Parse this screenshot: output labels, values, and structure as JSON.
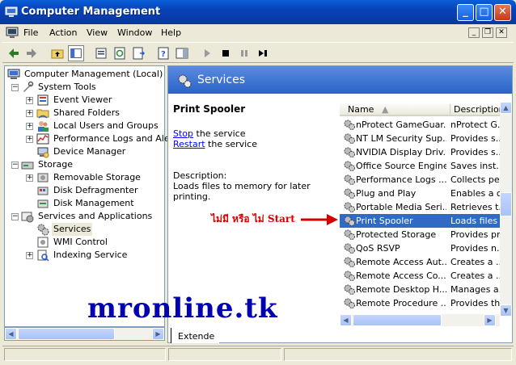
{
  "window": {
    "title": "Computer Management",
    "minimize_symbol": "_",
    "maximize_symbol": "□",
    "close_symbol": "✕"
  },
  "menu": {
    "items": [
      "File",
      "Action",
      "View",
      "Window",
      "Help"
    ],
    "mdi_minimize": "_",
    "mdi_restore": "❐",
    "mdi_close": "✕"
  },
  "toolbar": {
    "icons": [
      "back-icon",
      "forward-icon",
      "up-folder-icon",
      "show-tree-icon",
      "properties-icon",
      "refresh-icon",
      "export-list-icon",
      "help-icon",
      "description-icon",
      "play-icon",
      "stop-icon",
      "pause-icon",
      "restart-icon"
    ]
  },
  "tree": {
    "root": "Computer Management (Local)",
    "system_tools": "System Tools",
    "event_viewer": "Event Viewer",
    "shared_folders": "Shared Folders",
    "local_users": "Local Users and Groups",
    "perf_logs": "Performance Logs and Alerts",
    "device_manager": "Device Manager",
    "storage": "Storage",
    "removable_storage": "Removable Storage",
    "disk_defrag": "Disk Defragmenter",
    "disk_management": "Disk Management",
    "services_apps": "Services and Applications",
    "services": "Services",
    "wmi_control": "WMI Control",
    "indexing_service": "Indexing Service"
  },
  "details": {
    "header_title": "Services",
    "selected_service": "Print Spooler",
    "stop_link": "Stop",
    "stop_suffix": " the service",
    "restart_link": "Restart",
    "restart_suffix": " the service",
    "description_label": "Description:",
    "description_text": "Loads files to memory for later printing.",
    "extended_tab": "Extende"
  },
  "list": {
    "col_name": "Name",
    "col_desc": "Description",
    "rows": [
      {
        "name": "nProtect GameGuar...",
        "desc": "nProtect G..."
      },
      {
        "name": "NT LM Security Sup...",
        "desc": "Provides s..."
      },
      {
        "name": "NVIDIA Display Driv...",
        "desc": "Provides s..."
      },
      {
        "name": "Office Source Engine",
        "desc": "Saves inst..."
      },
      {
        "name": "Performance Logs ...",
        "desc": "Collects pe..."
      },
      {
        "name": "Plug and Play",
        "desc": "Enables a c..."
      },
      {
        "name": "Portable Media Seri...",
        "desc": "Retrieves t..."
      },
      {
        "name": "Print Spooler",
        "desc": "Loads files ..."
      },
      {
        "name": "Protected Storage",
        "desc": "Provides pr..."
      },
      {
        "name": "QoS RSVP",
        "desc": "Provides n..."
      },
      {
        "name": "Remote Access Aut...",
        "desc": "Creates a ..."
      },
      {
        "name": "Remote Access Co...",
        "desc": "Creates a ..."
      },
      {
        "name": "Remote Desktop H...",
        "desc": "Manages a..."
      },
      {
        "name": "Remote Procedure ...",
        "desc": "Provides th..."
      }
    ]
  },
  "annotation": {
    "text": "ไม่มี หรือ ไม่ Start",
    "color": "#d40000"
  },
  "watermark": "mronline.tk",
  "colors": {
    "title_bar": "#0842b8",
    "selection": "#316ac5",
    "header_panel": "#2a62c8"
  }
}
